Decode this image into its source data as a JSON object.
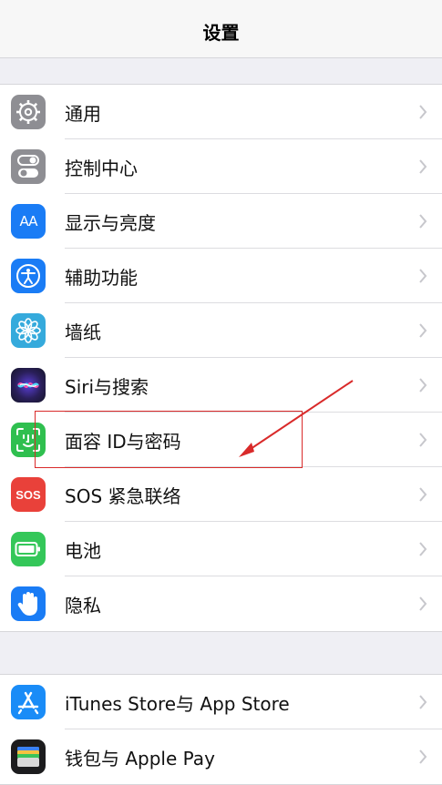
{
  "header": {
    "title": "设置"
  },
  "group1": {
    "items": [
      {
        "label": "通用",
        "icon": "gear-icon",
        "color": "#8e8e93"
      },
      {
        "label": "控制中心",
        "icon": "toggle-icon",
        "color": "#8e8e93"
      },
      {
        "label": "显示与亮度",
        "icon": "text-size-icon",
        "icon_text": "AA",
        "color": "#1a7cf5"
      },
      {
        "label": "辅助功能",
        "icon": "accessibility-icon",
        "color": "#1a7cf5"
      },
      {
        "label": "墙纸",
        "icon": "flower-icon",
        "color": "#35aadc"
      },
      {
        "label": "Siri与搜索",
        "icon": "siri-icon",
        "color": "#1c1c3a"
      },
      {
        "label": "面容 ID与密码",
        "icon": "face-id-icon",
        "color": "#2fbf4f"
      },
      {
        "label": "SOS 紧急联络",
        "icon": "sos-icon",
        "icon_text": "SOS",
        "color": "#e9413a"
      },
      {
        "label": "电池",
        "icon": "battery-icon",
        "color": "#34c759"
      },
      {
        "label": "隐私",
        "icon": "hand-icon",
        "color": "#1a7cf5"
      }
    ]
  },
  "group2": {
    "items": [
      {
        "label": "iTunes Store与 App Store",
        "icon": "app-store-icon",
        "color": "#1a8cf7"
      },
      {
        "label": "钱包与 Apple Pay",
        "icon": "wallet-icon",
        "color": "#1c1c1e"
      }
    ]
  },
  "annotation": {
    "color": "#d92a2a"
  }
}
